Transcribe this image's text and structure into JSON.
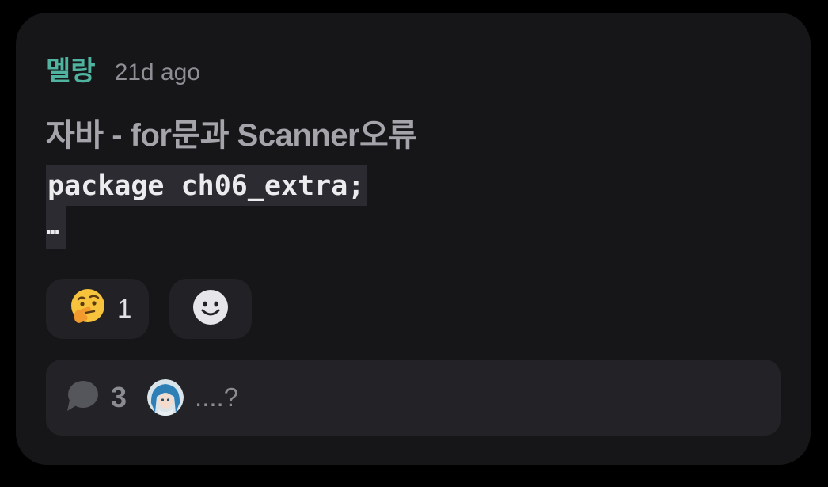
{
  "post": {
    "author": "멜랑",
    "timestamp": "21d ago",
    "title": "자바 - for문과 Scanner오류",
    "code_line": "package ch06_extra;",
    "code_ellipsis": "…"
  },
  "reactions": {
    "thinking": {
      "icon": "thinking-face-icon",
      "count": "1"
    },
    "add": {
      "icon": "smiley-add-icon"
    }
  },
  "replies": {
    "count": "3",
    "preview": "....?",
    "icon": "speech-bubble-icon"
  },
  "colors": {
    "author": "#4fb3a0",
    "card_bg": "#161619",
    "chip_bg": "#222226"
  }
}
